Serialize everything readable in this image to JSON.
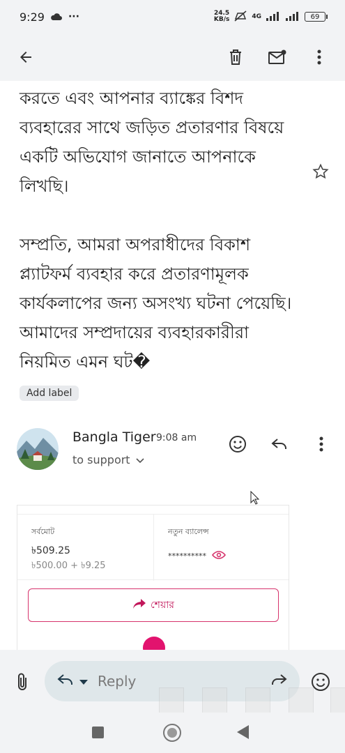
{
  "status_bar": {
    "time": "9:29",
    "more": "···",
    "data_speed_value": "24.5",
    "data_speed_unit": "KB/s",
    "network": "4G",
    "battery": "69"
  },
  "toolbar": {
    "icons": [
      "back-arrow-icon",
      "delete-icon",
      "mark-unread-icon",
      "more-vert-icon"
    ]
  },
  "message": {
    "paragraph1": "করতে এবং আপনার ব্যাঙ্কের বিশদ ব্যবহারের সাথে জড়িত প্রতারণার বিষয়ে একটি অভিযোগ জানাতে আপনাকে লিখছি।",
    "paragraph2": "সম্প্রতি, আমরা অপরাধীদের বিকাশ প্ল্যাটফর্ম ব্যবহার করে প্রতারণামূলক কার্যকলাপের জন্য অসংখ্য ঘটনা পেয়েছি। আমাদের সম্প্রদায়ের ব্যবহারকারীরা নিয়মিত এমন ঘট�"
  },
  "label_chip": "Add label",
  "sender": {
    "name": "Bangla Tiger",
    "time": "9:08 am",
    "to": "to support"
  },
  "card": {
    "total_label": "সর্বমোট",
    "total_value": "৳509.25",
    "total_breakdown": "৳500.00 + ৳9.25",
    "new_balance_label": "নতুন ব্যালেন্স",
    "new_balance_masked": "**********",
    "share_label": "শেয়ার"
  },
  "reply_bar": {
    "placeholder": "Reply"
  },
  "colors": {
    "accent_pink": "#e2136e",
    "surface": "#f2f3f5",
    "reply_pill": "#dfe7ea"
  }
}
